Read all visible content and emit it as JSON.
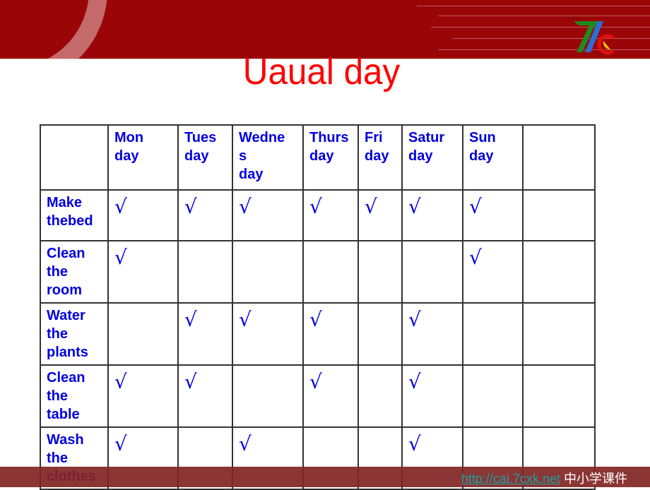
{
  "slide": {
    "title": "Uaual day",
    "logo_icon": "7c-logo-icon"
  },
  "table": {
    "header": [
      "",
      "Mon\nday",
      "Tues\nday",
      "Wedne\ns\nday",
      "Thurs\nday",
      "Fri\nday",
      "Satur\nday",
      "Sun\nday",
      ""
    ],
    "header_lines": [
      [],
      [
        "Mon",
        "day"
      ],
      [
        "Tues",
        "day"
      ],
      [
        "Wedne",
        "s",
        "day"
      ],
      [
        "Thurs",
        "day"
      ],
      [
        "Fri",
        "day"
      ],
      [
        "Satur",
        "day"
      ],
      [
        "Sun",
        "day"
      ],
      []
    ],
    "check_mark": "√",
    "rows": [
      {
        "label_lines": [
          "Make",
          "thebed"
        ],
        "checks": [
          true,
          true,
          true,
          true,
          true,
          true,
          true,
          false
        ]
      },
      {
        "label_lines": [
          "Clean",
          "the",
          "room"
        ],
        "checks": [
          true,
          false,
          false,
          false,
          false,
          false,
          true,
          false
        ]
      },
      {
        "label_lines": [
          "Water",
          "the",
          "plants"
        ],
        "checks": [
          false,
          true,
          true,
          true,
          false,
          true,
          false,
          false
        ]
      },
      {
        "label_lines": [
          "Clean",
          "the",
          "table"
        ],
        "checks": [
          true,
          true,
          false,
          true,
          false,
          true,
          false,
          false
        ]
      },
      {
        "label_lines": [
          "Wash",
          "the",
          "clothes"
        ],
        "checks": [
          true,
          false,
          true,
          false,
          false,
          true,
          false,
          false
        ]
      }
    ]
  },
  "footer": {
    "link": "http://cai.7cxk.net",
    "text": " 中小学课件"
  },
  "colors": {
    "banner": "#9a0608",
    "title": "#ff0000",
    "table_text": "#0000e0",
    "footer_bg": "#822424",
    "footer_link": "#1aa3a3"
  }
}
